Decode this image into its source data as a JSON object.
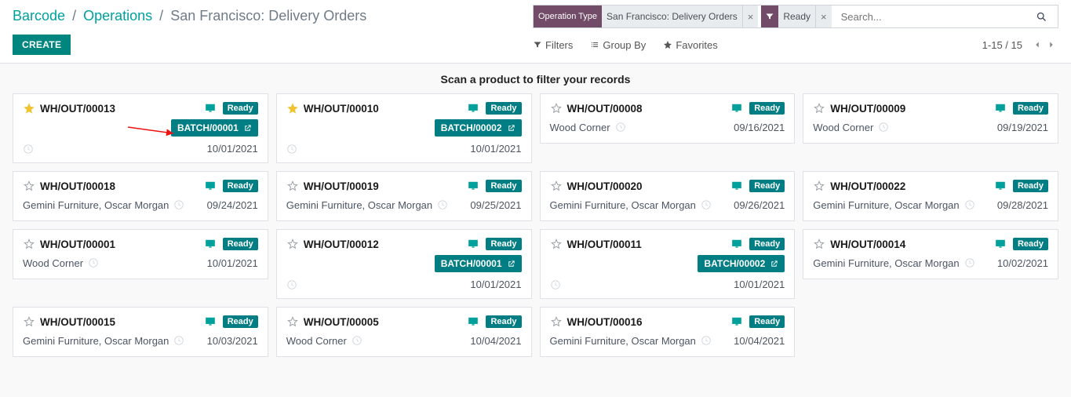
{
  "breadcrumbs": {
    "root": "Barcode",
    "mid": "Operations",
    "current": "San Francisco: Delivery Orders"
  },
  "search": {
    "facets": [
      {
        "type": "Operation Type",
        "value": "San Francisco: Delivery Orders",
        "icon": "label"
      },
      {
        "type": "",
        "value": "Ready",
        "icon": "funnel"
      }
    ],
    "placeholder": "Search..."
  },
  "buttons": {
    "create": "CREATE",
    "filters": "Filters",
    "group_by": "Group By",
    "favorites": "Favorites"
  },
  "paging": {
    "text": "1-15 / 15"
  },
  "scan_prompt": "Scan a product to filter your records",
  "status_label": "Ready",
  "cards": [
    {
      "ref": "WH/OUT/00013",
      "starred": true,
      "batch": "BATCH/00001",
      "partner": "",
      "date": "10/01/2021",
      "show_clock_bottom": true,
      "annot_arrow": true
    },
    {
      "ref": "WH/OUT/00010",
      "starred": true,
      "batch": "BATCH/00002",
      "partner": "",
      "date": "10/01/2021",
      "show_clock_bottom": true
    },
    {
      "ref": "WH/OUT/00008",
      "starred": false,
      "batch": "",
      "partner": "Wood Corner",
      "date": "09/16/2021"
    },
    {
      "ref": "WH/OUT/00009",
      "starred": false,
      "batch": "",
      "partner": "Wood Corner",
      "date": "09/19/2021"
    },
    {
      "ref": "WH/OUT/00018",
      "starred": false,
      "batch": "",
      "partner": "Gemini Furniture, Oscar Morgan",
      "date": "09/24/2021"
    },
    {
      "ref": "WH/OUT/00019",
      "starred": false,
      "batch": "",
      "partner": "Gemini Furniture, Oscar Morgan",
      "date": "09/25/2021"
    },
    {
      "ref": "WH/OUT/00020",
      "starred": false,
      "batch": "",
      "partner": "Gemini Furniture, Oscar Morgan",
      "date": "09/26/2021"
    },
    {
      "ref": "WH/OUT/00022",
      "starred": false,
      "batch": "",
      "partner": "Gemini Furniture, Oscar Morgan",
      "date": "09/28/2021"
    },
    {
      "ref": "WH/OUT/00001",
      "starred": false,
      "batch": "",
      "partner": "Wood Corner",
      "date": "10/01/2021"
    },
    {
      "ref": "WH/OUT/00012",
      "starred": false,
      "batch": "BATCH/00001",
      "partner": "",
      "date": "10/01/2021",
      "show_clock_bottom": true
    },
    {
      "ref": "WH/OUT/00011",
      "starred": false,
      "batch": "BATCH/00002",
      "partner": "",
      "date": "10/01/2021",
      "show_clock_bottom": true
    },
    {
      "ref": "WH/OUT/00014",
      "starred": false,
      "batch": "",
      "partner": "Gemini Furniture, Oscar Morgan",
      "date": "10/02/2021"
    },
    {
      "ref": "WH/OUT/00015",
      "starred": false,
      "batch": "",
      "partner": "Gemini Furniture, Oscar Morgan",
      "date": "10/03/2021"
    },
    {
      "ref": "WH/OUT/00005",
      "starred": false,
      "batch": "",
      "partner": "Wood Corner",
      "date": "10/04/2021"
    },
    {
      "ref": "WH/OUT/00016",
      "starred": false,
      "batch": "",
      "partner": "Gemini Furniture, Oscar Morgan",
      "date": "10/04/2021"
    }
  ]
}
